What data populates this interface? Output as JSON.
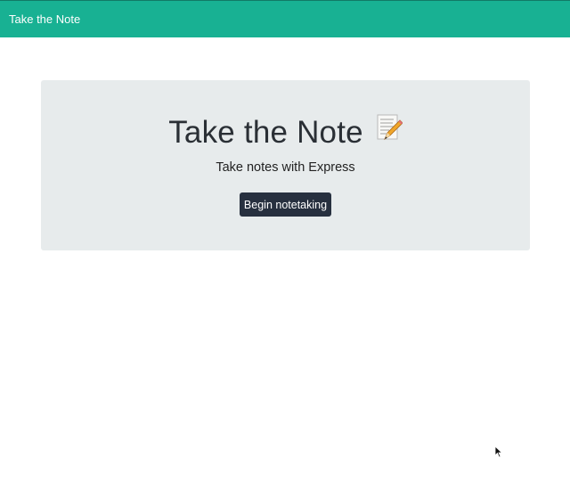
{
  "navbar": {
    "brand": "Take the Note",
    "background_color": "#18b193"
  },
  "hero": {
    "title": "Take the Note",
    "title_icon": "memo-pencil-icon",
    "subtitle": "Take notes with Express",
    "button_label": "Begin notetaking",
    "panel_color": "#e7ebec",
    "button_color": "#27303f"
  }
}
